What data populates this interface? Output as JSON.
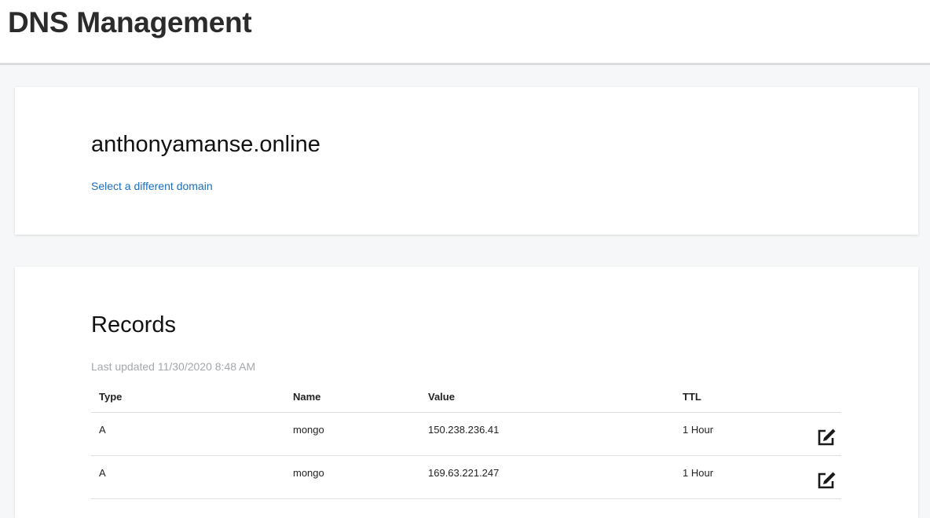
{
  "header": {
    "title": "DNS Management"
  },
  "domain": {
    "name": "anthonyamanse.online",
    "select_link": "Select a different domain"
  },
  "records": {
    "title": "Records",
    "last_updated": "Last updated 11/30/2020 8:48 AM",
    "columns": {
      "type": "Type",
      "name": "Name",
      "value": "Value",
      "ttl": "TTL"
    },
    "rows": [
      {
        "type": "A",
        "name": "mongo",
        "value": "150.238.236.41",
        "ttl": "1 Hour",
        "action_icon": "edit-icon"
      },
      {
        "type": "A",
        "name": "mongo",
        "value": "169.63.221.247",
        "ttl": "1 Hour",
        "action_icon": "edit-icon"
      }
    ]
  },
  "colors": {
    "link": "#1b6ec2",
    "muted_text": "#a3a8ad",
    "page_background": "#f5f7f8"
  }
}
